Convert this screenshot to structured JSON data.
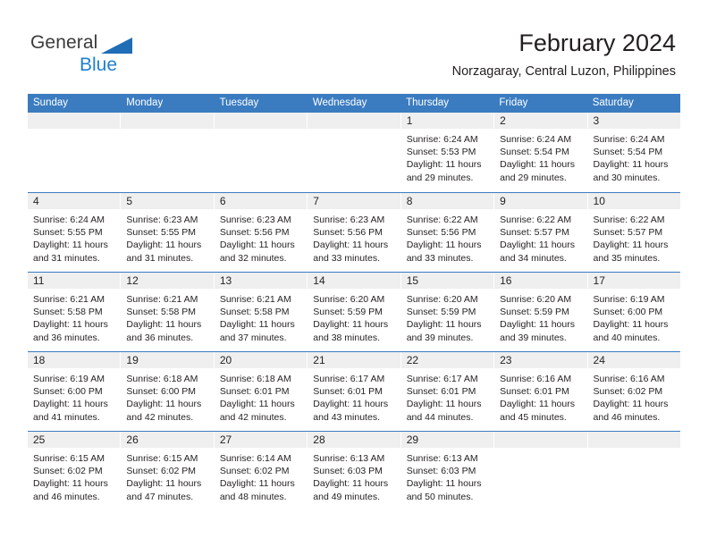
{
  "brand": {
    "name_primary": "General",
    "name_secondary": "Blue",
    "triangle_color": "#1f6db5",
    "secondary_color": "#1f7fd0"
  },
  "header": {
    "month_title": "February 2024",
    "location": "Norzagaray, Central Luzon, Philippines"
  },
  "colors": {
    "header_blue": "#3b7cc0",
    "day_band_gray": "#efefef",
    "text": "#231f20"
  },
  "weekdays": [
    "Sunday",
    "Monday",
    "Tuesday",
    "Wednesday",
    "Thursday",
    "Friday",
    "Saturday"
  ],
  "weeks": [
    [
      {
        "day": "",
        "sunrise": "",
        "sunset": "",
        "daylight1": "",
        "daylight2": ""
      },
      {
        "day": "",
        "sunrise": "",
        "sunset": "",
        "daylight1": "",
        "daylight2": ""
      },
      {
        "day": "",
        "sunrise": "",
        "sunset": "",
        "daylight1": "",
        "daylight2": ""
      },
      {
        "day": "",
        "sunrise": "",
        "sunset": "",
        "daylight1": "",
        "daylight2": ""
      },
      {
        "day": "1",
        "sunrise": "Sunrise: 6:24 AM",
        "sunset": "Sunset: 5:53 PM",
        "daylight1": "Daylight: 11 hours",
        "daylight2": "and 29 minutes."
      },
      {
        "day": "2",
        "sunrise": "Sunrise: 6:24 AM",
        "sunset": "Sunset: 5:54 PM",
        "daylight1": "Daylight: 11 hours",
        "daylight2": "and 29 minutes."
      },
      {
        "day": "3",
        "sunrise": "Sunrise: 6:24 AM",
        "sunset": "Sunset: 5:54 PM",
        "daylight1": "Daylight: 11 hours",
        "daylight2": "and 30 minutes."
      }
    ],
    [
      {
        "day": "4",
        "sunrise": "Sunrise: 6:24 AM",
        "sunset": "Sunset: 5:55 PM",
        "daylight1": "Daylight: 11 hours",
        "daylight2": "and 31 minutes."
      },
      {
        "day": "5",
        "sunrise": "Sunrise: 6:23 AM",
        "sunset": "Sunset: 5:55 PM",
        "daylight1": "Daylight: 11 hours",
        "daylight2": "and 31 minutes."
      },
      {
        "day": "6",
        "sunrise": "Sunrise: 6:23 AM",
        "sunset": "Sunset: 5:56 PM",
        "daylight1": "Daylight: 11 hours",
        "daylight2": "and 32 minutes."
      },
      {
        "day": "7",
        "sunrise": "Sunrise: 6:23 AM",
        "sunset": "Sunset: 5:56 PM",
        "daylight1": "Daylight: 11 hours",
        "daylight2": "and 33 minutes."
      },
      {
        "day": "8",
        "sunrise": "Sunrise: 6:22 AM",
        "sunset": "Sunset: 5:56 PM",
        "daylight1": "Daylight: 11 hours",
        "daylight2": "and 33 minutes."
      },
      {
        "day": "9",
        "sunrise": "Sunrise: 6:22 AM",
        "sunset": "Sunset: 5:57 PM",
        "daylight1": "Daylight: 11 hours",
        "daylight2": "and 34 minutes."
      },
      {
        "day": "10",
        "sunrise": "Sunrise: 6:22 AM",
        "sunset": "Sunset: 5:57 PM",
        "daylight1": "Daylight: 11 hours",
        "daylight2": "and 35 minutes."
      }
    ],
    [
      {
        "day": "11",
        "sunrise": "Sunrise: 6:21 AM",
        "sunset": "Sunset: 5:58 PM",
        "daylight1": "Daylight: 11 hours",
        "daylight2": "and 36 minutes."
      },
      {
        "day": "12",
        "sunrise": "Sunrise: 6:21 AM",
        "sunset": "Sunset: 5:58 PM",
        "daylight1": "Daylight: 11 hours",
        "daylight2": "and 36 minutes."
      },
      {
        "day": "13",
        "sunrise": "Sunrise: 6:21 AM",
        "sunset": "Sunset: 5:58 PM",
        "daylight1": "Daylight: 11 hours",
        "daylight2": "and 37 minutes."
      },
      {
        "day": "14",
        "sunrise": "Sunrise: 6:20 AM",
        "sunset": "Sunset: 5:59 PM",
        "daylight1": "Daylight: 11 hours",
        "daylight2": "and 38 minutes."
      },
      {
        "day": "15",
        "sunrise": "Sunrise: 6:20 AM",
        "sunset": "Sunset: 5:59 PM",
        "daylight1": "Daylight: 11 hours",
        "daylight2": "and 39 minutes."
      },
      {
        "day": "16",
        "sunrise": "Sunrise: 6:20 AM",
        "sunset": "Sunset: 5:59 PM",
        "daylight1": "Daylight: 11 hours",
        "daylight2": "and 39 minutes."
      },
      {
        "day": "17",
        "sunrise": "Sunrise: 6:19 AM",
        "sunset": "Sunset: 6:00 PM",
        "daylight1": "Daylight: 11 hours",
        "daylight2": "and 40 minutes."
      }
    ],
    [
      {
        "day": "18",
        "sunrise": "Sunrise: 6:19 AM",
        "sunset": "Sunset: 6:00 PM",
        "daylight1": "Daylight: 11 hours",
        "daylight2": "and 41 minutes."
      },
      {
        "day": "19",
        "sunrise": "Sunrise: 6:18 AM",
        "sunset": "Sunset: 6:00 PM",
        "daylight1": "Daylight: 11 hours",
        "daylight2": "and 42 minutes."
      },
      {
        "day": "20",
        "sunrise": "Sunrise: 6:18 AM",
        "sunset": "Sunset: 6:01 PM",
        "daylight1": "Daylight: 11 hours",
        "daylight2": "and 42 minutes."
      },
      {
        "day": "21",
        "sunrise": "Sunrise: 6:17 AM",
        "sunset": "Sunset: 6:01 PM",
        "daylight1": "Daylight: 11 hours",
        "daylight2": "and 43 minutes."
      },
      {
        "day": "22",
        "sunrise": "Sunrise: 6:17 AM",
        "sunset": "Sunset: 6:01 PM",
        "daylight1": "Daylight: 11 hours",
        "daylight2": "and 44 minutes."
      },
      {
        "day": "23",
        "sunrise": "Sunrise: 6:16 AM",
        "sunset": "Sunset: 6:01 PM",
        "daylight1": "Daylight: 11 hours",
        "daylight2": "and 45 minutes."
      },
      {
        "day": "24",
        "sunrise": "Sunrise: 6:16 AM",
        "sunset": "Sunset: 6:02 PM",
        "daylight1": "Daylight: 11 hours",
        "daylight2": "and 46 minutes."
      }
    ],
    [
      {
        "day": "25",
        "sunrise": "Sunrise: 6:15 AM",
        "sunset": "Sunset: 6:02 PM",
        "daylight1": "Daylight: 11 hours",
        "daylight2": "and 46 minutes."
      },
      {
        "day": "26",
        "sunrise": "Sunrise: 6:15 AM",
        "sunset": "Sunset: 6:02 PM",
        "daylight1": "Daylight: 11 hours",
        "daylight2": "and 47 minutes."
      },
      {
        "day": "27",
        "sunrise": "Sunrise: 6:14 AM",
        "sunset": "Sunset: 6:02 PM",
        "daylight1": "Daylight: 11 hours",
        "daylight2": "and 48 minutes."
      },
      {
        "day": "28",
        "sunrise": "Sunrise: 6:13 AM",
        "sunset": "Sunset: 6:03 PM",
        "daylight1": "Daylight: 11 hours",
        "daylight2": "and 49 minutes."
      },
      {
        "day": "29",
        "sunrise": "Sunrise: 6:13 AM",
        "sunset": "Sunset: 6:03 PM",
        "daylight1": "Daylight: 11 hours",
        "daylight2": "and 50 minutes."
      },
      {
        "day": "",
        "sunrise": "",
        "sunset": "",
        "daylight1": "",
        "daylight2": ""
      },
      {
        "day": "",
        "sunrise": "",
        "sunset": "",
        "daylight1": "",
        "daylight2": ""
      }
    ]
  ]
}
